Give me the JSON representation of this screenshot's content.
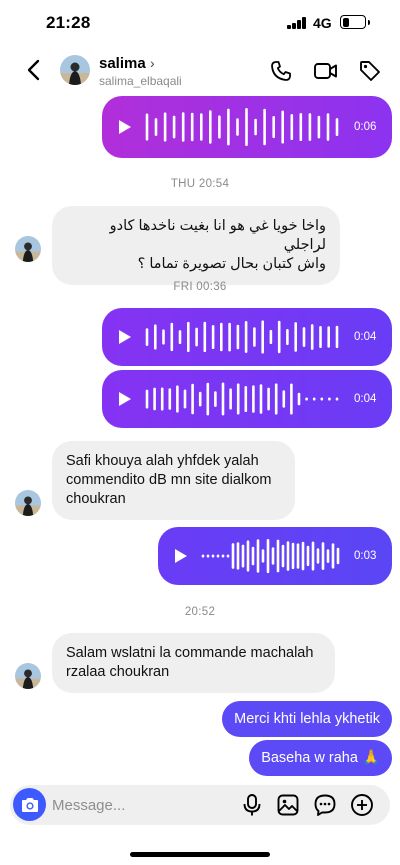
{
  "status_bar": {
    "time": "21:28",
    "network": "4G",
    "battery_level": 0.3
  },
  "header": {
    "name": "salima",
    "username": "salima_elbaqali",
    "icons": [
      "back-arrow",
      "phone",
      "video-camera",
      "tag"
    ]
  },
  "messages": [
    {
      "type": "voice",
      "direction": "out",
      "duration": "0:06"
    },
    {
      "type": "timestamp",
      "text": "THU 20:54"
    },
    {
      "type": "text",
      "direction": "in",
      "lines": [
        "واخا خويا غي هو انا بغيت ناخدها كادو لراجلي",
        "واش كتبان بحال تصويرة تماما ؟"
      ]
    },
    {
      "type": "timestamp",
      "text": "FRI 00:36"
    },
    {
      "type": "voice",
      "direction": "out",
      "duration": "0:04"
    },
    {
      "type": "voice",
      "direction": "out",
      "duration": "0:04"
    },
    {
      "type": "text",
      "direction": "in",
      "lines": [
        "Safi khouya alah yhfdek yalah",
        "commendito dB mn site dialkom",
        "choukran"
      ]
    },
    {
      "type": "voice",
      "direction": "out",
      "duration": "0:03"
    },
    {
      "type": "timestamp",
      "text": "20:52"
    },
    {
      "type": "text",
      "direction": "in",
      "lines": [
        "Salam wslatni la commande machalah",
        "rzalaa choukran"
      ]
    },
    {
      "type": "text",
      "direction": "out",
      "text": "Merci khti lehla ykhetik"
    },
    {
      "type": "text",
      "direction": "out",
      "text": "Baseha w raha 🙏"
    }
  ],
  "composer": {
    "placeholder": "Message...",
    "icons": [
      "camera",
      "microphone",
      "gallery",
      "sticker",
      "add"
    ]
  },
  "colors": {
    "voice_gradient_1": [
      "#b12fd9",
      "#8c33f0"
    ],
    "voice_gradient_2": [
      "#8533f2",
      "#6a3cf5"
    ],
    "voice_gradient_3": [
      "#6a3cf5",
      "#5a46f5"
    ],
    "out_text": "#5b4af5",
    "in_bubble": "#efefef",
    "camera_button": "#3d5afe"
  }
}
